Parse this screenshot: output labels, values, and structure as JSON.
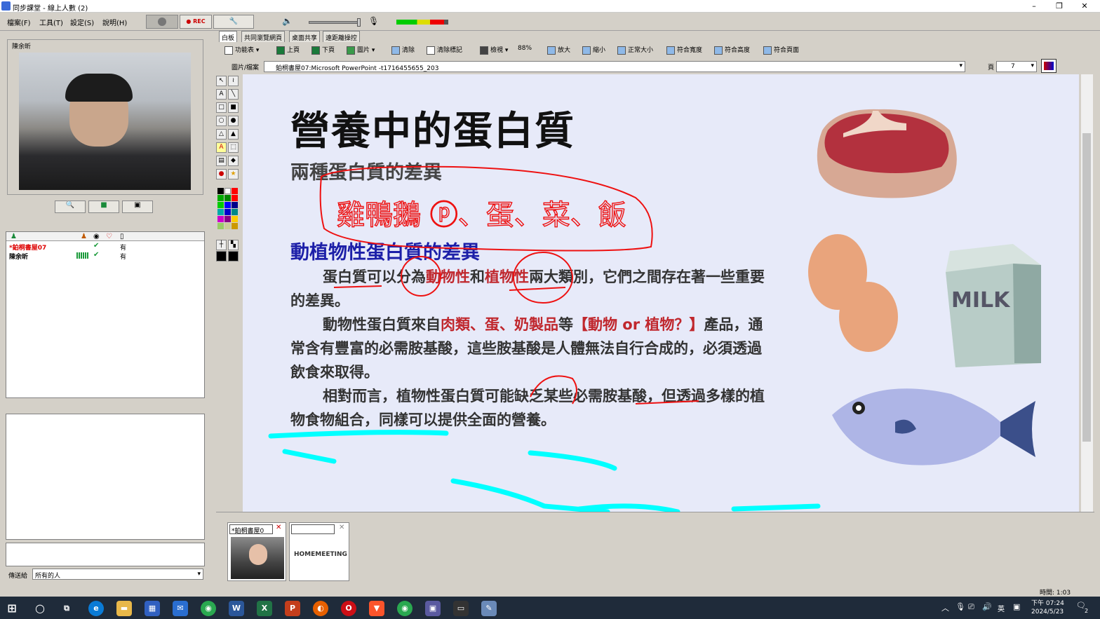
{
  "window": {
    "title": "同步課堂 - 線上人數 (2)",
    "minimize": "–",
    "maximize": "❐",
    "close": "✕"
  },
  "menu": {
    "file": "檔案(F)",
    "tools": "工具(T)",
    "settings": "設定(S)",
    "help": "說明(H)",
    "rec": "REC"
  },
  "tabs": [
    "白板",
    "共同瀏覽網頁",
    "桌面共享",
    "遠距離操控"
  ],
  "toolbar": {
    "function_table": "功能表",
    "prev_page": "上頁",
    "next_page": "下頁",
    "image": "圖片",
    "clear": "清除",
    "clear_marks": "清除標記",
    "view": "檢視",
    "zoom": "88%",
    "zoom_in": "放大",
    "zoom_out": "縮小",
    "normal_size": "正常大小",
    "fit_width": "符合寬度",
    "fit_height": "符合高度",
    "fit_page": "符合頁面"
  },
  "file_bar": {
    "label": "圖片/檔案",
    "value": "鉑桐書屋07:Microsoft PowerPoint -t1716455655_203",
    "page_label": "頁",
    "page_value": "7"
  },
  "webcam": {
    "name": "陳余昕"
  },
  "users": {
    "rows": [
      {
        "name": "*鉑桐書屋07",
        "check": "✔",
        "status": "有"
      },
      {
        "name": "陳余昕",
        "check": "✔",
        "status": "有"
      }
    ]
  },
  "chat": {
    "send_to_label": "傳送給",
    "send_to_value": "所有的人"
  },
  "slide": {
    "title": "營養中的蛋白質",
    "subtitle": "兩種蛋白質的差異",
    "heading": "動植物性蛋白質的差異",
    "p1_a": "蛋白質可以分為",
    "p1_b": "動物性",
    "p1_c": "和",
    "p1_d": "植物性",
    "p1_e": "兩大類別，它們之間存在著一些重要的差異。",
    "p2_a": "動物性蛋白質來自",
    "p2_b": "肉類、蛋、奶製品",
    "p2_c": "等",
    "p2_d": "【動物 or 植物？】",
    "p2_e": "產品，通常含有豐富的必需胺基酸，這些胺基酸是人體無法自行合成的，必須透過飲食來取得。",
    "p3": "相對而言，植物性蛋白質可能缺乏某些必需胺基酸，但透過多樣的植物食物組合，同樣可以提供全面的營養。",
    "milk": "MILK",
    "handwriting": "雞鴨鵝 ⓟ、蛋、菜、飯"
  },
  "bottom": {
    "video1_label": "*鉑桐書屋0",
    "brand": "HOMEMEETING",
    "timer": "時間: 1:03"
  },
  "taskbar": {
    "time": "下午 07:24",
    "date": "2024/5/23",
    "ime": "英",
    "notif": "2"
  }
}
